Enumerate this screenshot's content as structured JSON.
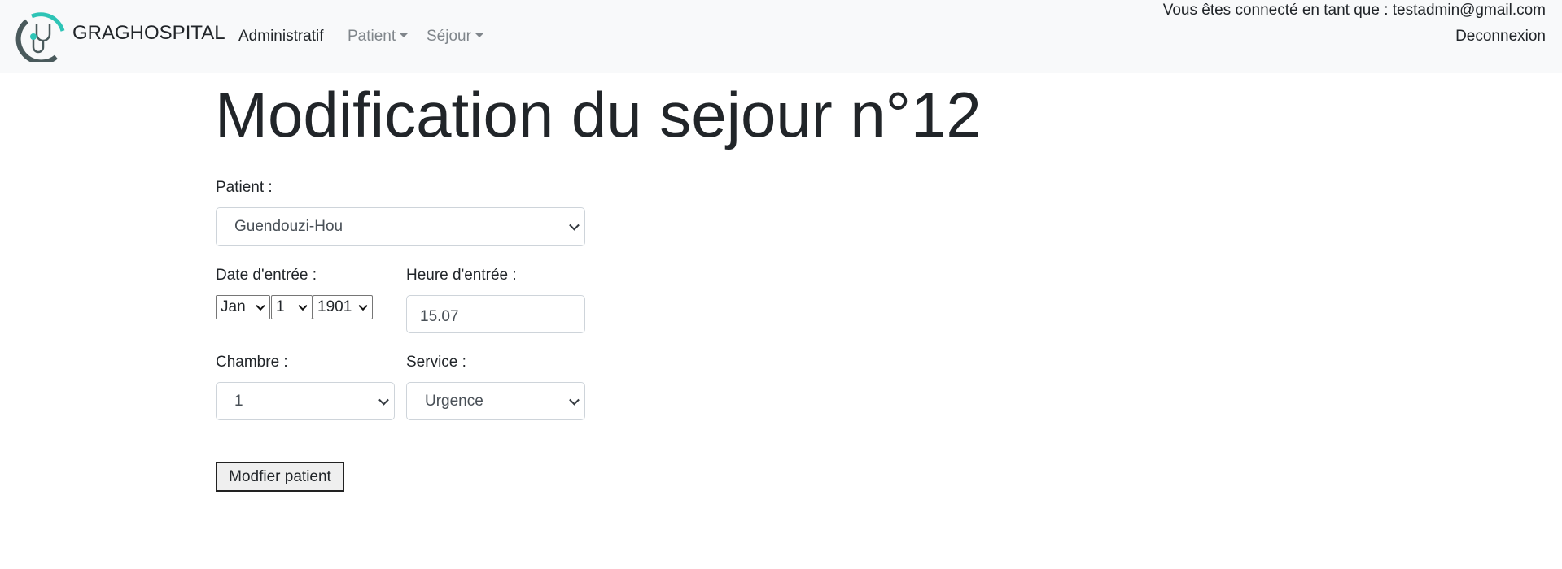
{
  "navbar": {
    "brand": "GRAGHOSPITAL",
    "links": [
      {
        "label": "Administratif",
        "dropdown": false
      },
      {
        "label": "Patient",
        "dropdown": true
      },
      {
        "label": "Séjour",
        "dropdown": true
      }
    ],
    "user_text": "Vous êtes connecté en tant que : testadmin@gmail.com",
    "logout": "Deconnexion"
  },
  "page": {
    "title": "Modification du sejour n°12"
  },
  "form": {
    "patient_label": "Patient :",
    "patient_value": "Guendouzi-Hou",
    "date_label": "Date d'entrée :",
    "date_month": "Jan",
    "date_day": "1",
    "date_year": "1901",
    "heure_label": "Heure d'entrée :",
    "heure_value": "15.07",
    "chambre_label": "Chambre :",
    "chambre_value": "1",
    "service_label": "Service :",
    "service_value": "Urgence",
    "submit": "Modfier patient"
  },
  "colors": {
    "navbar_bg": "#f8f9fa",
    "logo_teal": "#2ec4b6",
    "logo_gray": "#4a5a5c"
  }
}
